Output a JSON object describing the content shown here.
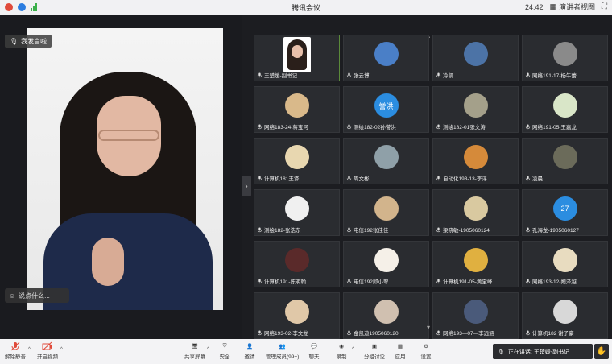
{
  "window": {
    "title": "腾讯会议",
    "time": "24:42",
    "view_label": "演讲者视图",
    "fullscreen_icon": "fullscreen-icon"
  },
  "speaker": {
    "mic_label": "我发言啦",
    "chat_placeholder": "说点什么..."
  },
  "gallery": [
    {
      "name": "王楚媛-副书记",
      "avatar": "photo",
      "color": "#ffffff",
      "text": "",
      "active": true
    },
    {
      "name": "张云博",
      "avatar": "img",
      "color": "#4a7fc7",
      "text": ""
    },
    {
      "name": "冷凯",
      "avatar": "img",
      "color": "#4c73a6",
      "text": ""
    },
    {
      "name": "网络191-17-杨午蕾",
      "avatar": "img",
      "color": "#8a8a8a",
      "text": ""
    },
    {
      "name": "网络183-24-蒋宝河",
      "avatar": "img",
      "color": "#d9b98a",
      "text": ""
    },
    {
      "name": "测绘182-02孙誉洪",
      "avatar": "text",
      "color": "#2b8de0",
      "text": "誉洪"
    },
    {
      "name": "测绘182-01张文涛",
      "avatar": "img",
      "color": "#a4a08a",
      "text": ""
    },
    {
      "name": "网络191-05-王嘉龙",
      "avatar": "img",
      "color": "#d9e6c8",
      "text": ""
    },
    {
      "name": "计算机181王译",
      "avatar": "img",
      "color": "#e8d7b0",
      "text": ""
    },
    {
      "name": "周文彬",
      "avatar": "img",
      "color": "#8fa0a8",
      "text": ""
    },
    {
      "name": "自动化193-13-李浮",
      "avatar": "img",
      "color": "#d58a3a",
      "text": ""
    },
    {
      "name": "凌晨",
      "avatar": "img",
      "color": "#6b6b5a",
      "text": ""
    },
    {
      "name": "测绘182-张浩东",
      "avatar": "img",
      "color": "#f0f0f0",
      "text": ""
    },
    {
      "name": "电信192张佳佳",
      "avatar": "img",
      "color": "#d2b48c",
      "text": ""
    },
    {
      "name": "梁晓敏-1905060124",
      "avatar": "img",
      "color": "#d9c9a0",
      "text": ""
    },
    {
      "name": "孔海龙-1905060127",
      "avatar": "text",
      "color": "#2b8de0",
      "text": "27"
    },
    {
      "name": "计算机191-陈明翰",
      "avatar": "img",
      "color": "#5a2a2a",
      "text": ""
    },
    {
      "name": "电信192邱小翠",
      "avatar": "img",
      "color": "#f5f0e8",
      "text": ""
    },
    {
      "name": "计算机191-05-黄宝峰",
      "avatar": "img",
      "color": "#e0b040",
      "text": ""
    },
    {
      "name": "网络193-12-阚泽越",
      "avatar": "img",
      "color": "#e8dcc0",
      "text": ""
    },
    {
      "name": "网络193-02-李文龙",
      "avatar": "img",
      "color": "#e0c8a8",
      "text": ""
    },
    {
      "name": "金凯迪1905060120",
      "avatar": "img",
      "color": "#d0c0b0",
      "text": ""
    },
    {
      "name": "网络193—07—李远涵",
      "avatar": "img",
      "color": "#4a5a7a",
      "text": ""
    },
    {
      "name": "计算机182 谢子豪",
      "avatar": "img",
      "color": "#d8d8d8",
      "text": ""
    }
  ],
  "toolbar": {
    "mute": "解除静音",
    "video": "开启视频",
    "share": "共享屏幕",
    "security": "安全",
    "invite": "邀请",
    "members": "管理成员(99+)",
    "chat": "聊天",
    "record": "录制",
    "breakout": "分组讨论",
    "apps": "应用",
    "settings": "设置",
    "speaking": "正在讲话: 王楚媛-副书记"
  }
}
